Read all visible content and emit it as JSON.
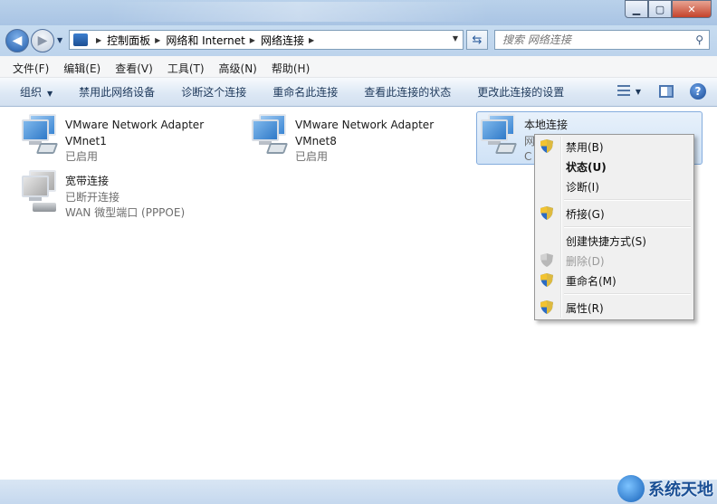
{
  "window": {
    "min": "▁",
    "max": "▢",
    "close": "✕"
  },
  "nav": {
    "breadcrumb": [
      "控制面板",
      "网络和 Internet",
      "网络连接"
    ],
    "search_placeholder": "搜索 网络连接"
  },
  "menubar": [
    "文件(F)",
    "编辑(E)",
    "查看(V)",
    "工具(T)",
    "高级(N)",
    "帮助(H)"
  ],
  "commands": {
    "organize": "组织",
    "disable": "禁用此网络设备",
    "diagnose": "诊断这个连接",
    "rename": "重命名此连接",
    "status": "查看此连接的状态",
    "settings": "更改此连接的设置"
  },
  "connections": [
    {
      "name": "VMware Network Adapter",
      "line2": "VMnet1",
      "line3": "已启用"
    },
    {
      "name": "VMware Network Adapter",
      "line2": "VMnet8",
      "line3": "已启用"
    },
    {
      "name": "本地连接",
      "line2": "网",
      "line3": "C"
    },
    {
      "name": "宽带连接",
      "line2": "已断开连接",
      "line3": "WAN 微型端口 (PPPOE)"
    }
  ],
  "context_menu": {
    "disable": "禁用(B)",
    "status": "状态(U)",
    "diagnose": "诊断(I)",
    "bridge": "桥接(G)",
    "shortcut": "创建快捷方式(S)",
    "delete": "删除(D)",
    "rename": "重命名(M)",
    "properties": "属性(R)"
  },
  "watermark": "系统天地",
  "colors": {
    "accent": "#1e395b",
    "selection": "#cfe2f6",
    "shield_blue": "#2c6cc4",
    "shield_yellow": "#f2c331"
  }
}
